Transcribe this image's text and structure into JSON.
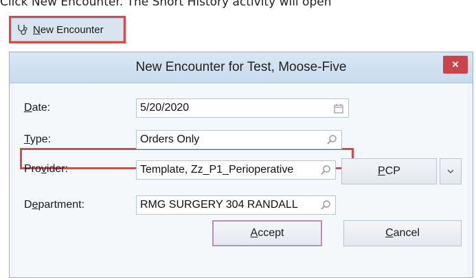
{
  "instruction": "Click New Encounter. The Short History activity will open",
  "toolbar": {
    "new_encounter_label_first": "N",
    "new_encounter_label_rest": "ew Encounter",
    "icon": "stethoscope-icon"
  },
  "dialog": {
    "title": "New Encounter for Test, Moose-Five",
    "close_label": "×"
  },
  "form": {
    "date_label_ul": "D",
    "date_label_rest": "ate:",
    "date_value": "5/20/2020",
    "type_label_ul": "T",
    "type_label_rest": "ype:",
    "type_value": "Orders Only",
    "provider_label_pre": "Pro",
    "provider_label_ul": "v",
    "provider_label_rest": "ider:",
    "provider_value": "Template, Zz_P1_Perioperative",
    "department_label_pre": "D",
    "department_label_ul": "e",
    "department_label_rest": "partment:",
    "department_value": "RMG SURGERY 304 RANDALL"
  },
  "buttons": {
    "pcp_ul": "P",
    "pcp_rest": "CP",
    "accept_ul": "A",
    "accept_rest": "ccept",
    "cancel_ul": "C",
    "cancel_rest": "ancel"
  },
  "colors": {
    "highlight": "#e0454c",
    "close_button": "#c9454a",
    "title_bar": "#d9e7f4"
  }
}
